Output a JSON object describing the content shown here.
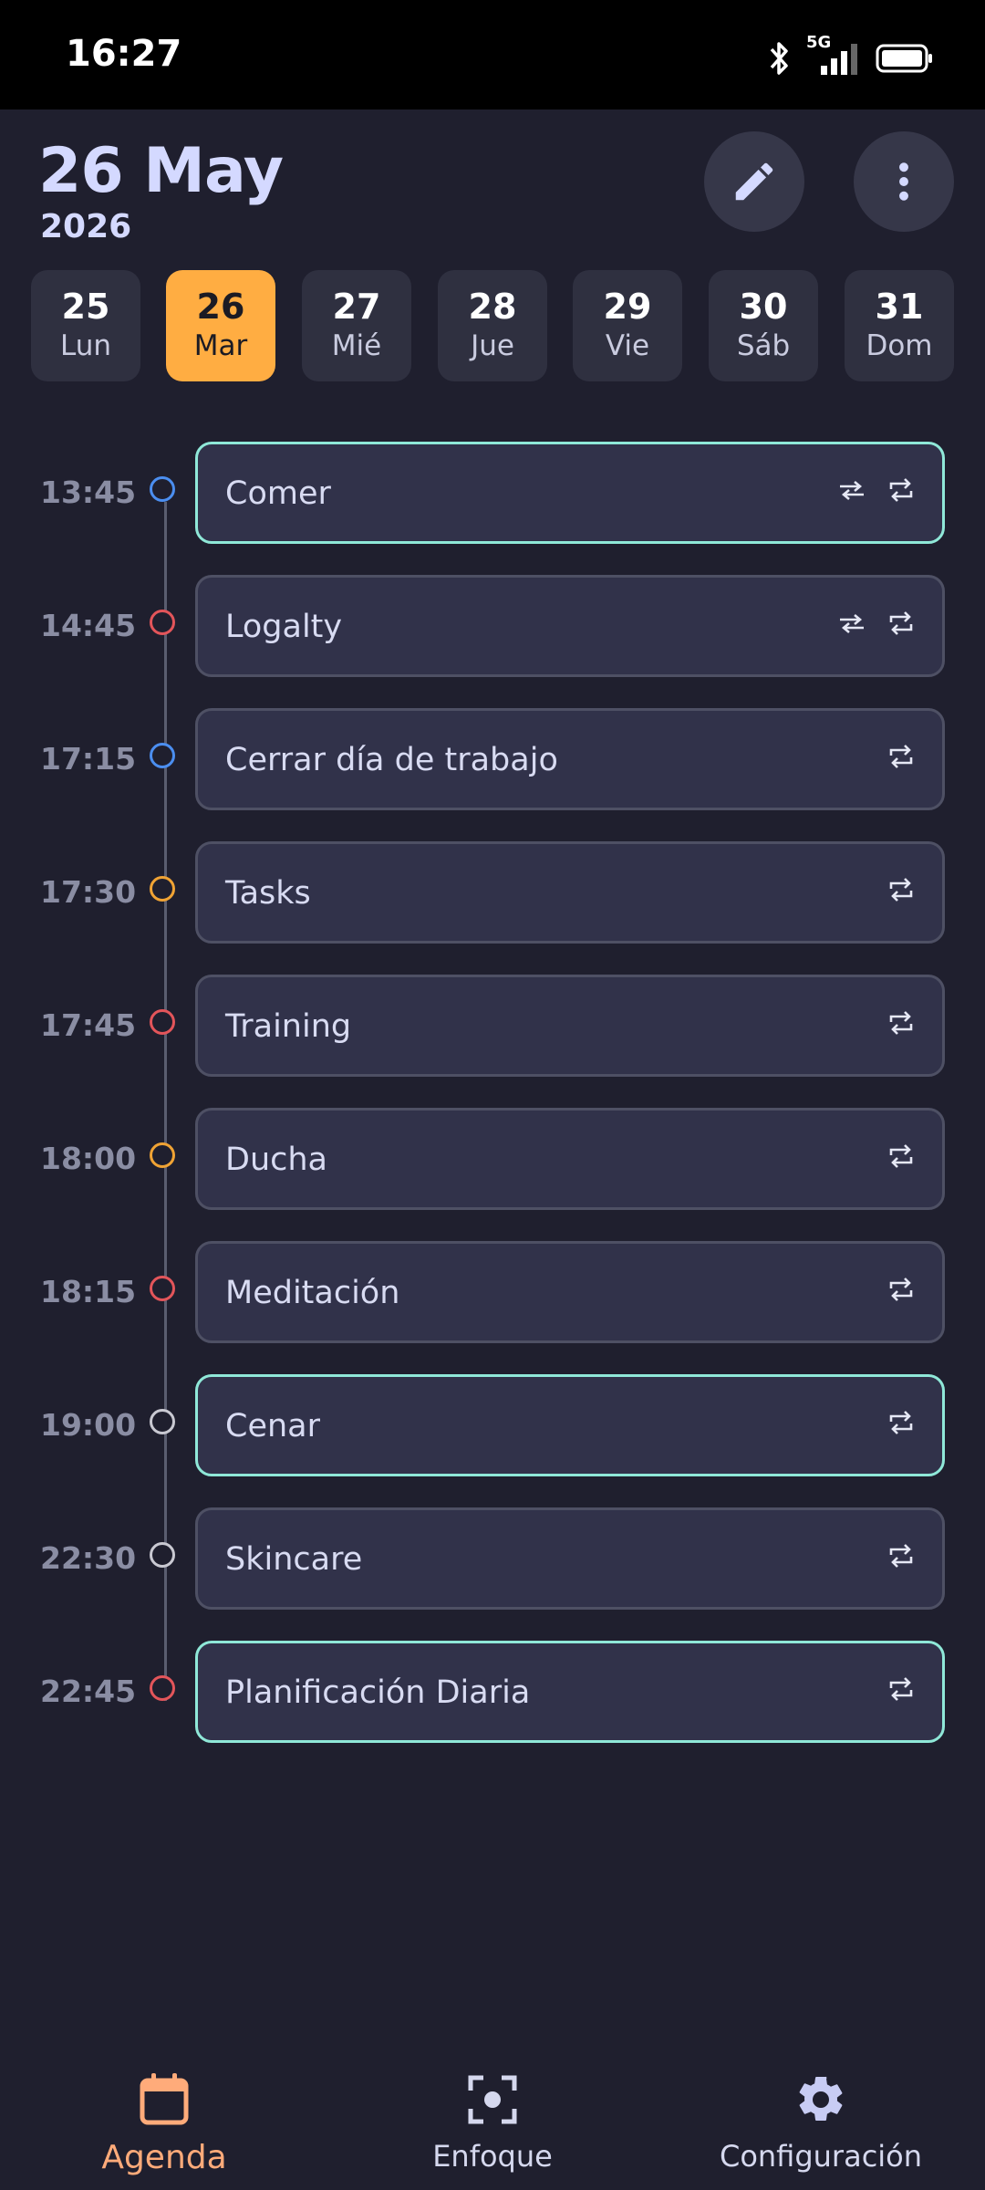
{
  "status_bar": {
    "time": "16:27",
    "network": "5G"
  },
  "header": {
    "date": "26 May",
    "year": "2026",
    "edit_icon": "pencil-icon",
    "more_icon": "more-vertical-icon"
  },
  "days": [
    {
      "num": "25",
      "name": "Lun"
    },
    {
      "num": "26",
      "name": "Mar",
      "active": true
    },
    {
      "num": "27",
      "name": "Mié"
    },
    {
      "num": "28",
      "name": "Jue"
    },
    {
      "num": "29",
      "name": "Vie"
    },
    {
      "num": "30",
      "name": "Sáb"
    },
    {
      "num": "31",
      "name": "Dom"
    }
  ],
  "events": [
    {
      "time": "13:45",
      "title": "Comer",
      "dot": "blue",
      "highlight": true,
      "swap": true
    },
    {
      "time": "14:45",
      "title": "Logalty",
      "dot": "red",
      "highlight": false,
      "swap": true
    },
    {
      "time": "17:15",
      "title": "Cerrar día de trabajo",
      "dot": "blue",
      "highlight": false,
      "swap": false
    },
    {
      "time": "17:30",
      "title": "Tasks",
      "dot": "orange",
      "highlight": false,
      "swap": false
    },
    {
      "time": "17:45",
      "title": "Training",
      "dot": "red",
      "highlight": false,
      "swap": false
    },
    {
      "time": "18:00",
      "title": "Ducha",
      "dot": "orange",
      "highlight": false,
      "swap": false
    },
    {
      "time": "18:15",
      "title": "Meditación",
      "dot": "red",
      "highlight": false,
      "swap": false
    },
    {
      "time": "19:00",
      "title": "Cenar",
      "dot": "white",
      "highlight": true,
      "swap": false
    },
    {
      "time": "22:30",
      "title": "Skincare",
      "dot": "white",
      "highlight": false,
      "swap": false
    },
    {
      "time": "22:45",
      "title": "Planificación Diaria",
      "dot": "red",
      "highlight": true,
      "swap": false
    }
  ],
  "nav": [
    {
      "label": "Agenda",
      "icon": "calendar-icon",
      "active": true
    },
    {
      "label": "Enfoque",
      "icon": "focus-icon",
      "active": false
    },
    {
      "label": "Configuración",
      "icon": "gear-icon",
      "active": false
    }
  ],
  "colors": {
    "background": "#1f1f2e",
    "accent": "#ffad42",
    "highlight_border": "#8fe8d8",
    "nav_active": "#ffab7a"
  }
}
